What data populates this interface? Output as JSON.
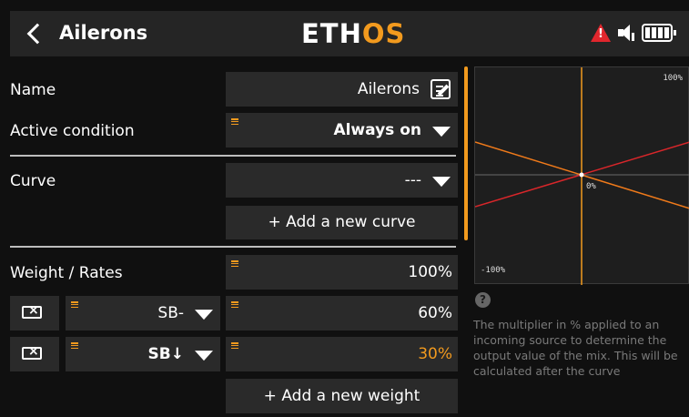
{
  "header": {
    "title": "Ailerons",
    "logo_prefix": "ETH",
    "logo_accent": "OS"
  },
  "form": {
    "name_label": "Name",
    "name_value": "Ailerons",
    "active_condition_label": "Active condition",
    "active_condition_value": "Always on",
    "curve_label": "Curve",
    "curve_value": "---",
    "add_curve_label": "+ Add a new curve",
    "weight_label": "Weight / Rates",
    "weight_value": "100%",
    "rates": [
      {
        "switch": "SB-",
        "value": "60%"
      },
      {
        "switch": "SB↓",
        "value": "30%"
      }
    ],
    "add_weight_label": "+ Add a new weight"
  },
  "graph": {
    "label_top": "100%",
    "label_center": "0%",
    "label_bottom": "-100%"
  },
  "help": {
    "text": "The multiplier in % applied to an incoming source to determine the output value of the mix. This will be calculated after the curve"
  },
  "colors": {
    "accent": "#f29a1e",
    "warning": "#e1262d",
    "line_red": "#d8262a",
    "line_orange": "#f07a1a"
  },
  "icons": {
    "back": "chevron-left-icon",
    "warning": "warning-triangle-icon",
    "volume": "speaker-icon",
    "battery": "battery-icon",
    "edit": "edit-icon",
    "dropdown": "caret-down-icon",
    "clear": "clear-icon",
    "help": "help-icon"
  }
}
